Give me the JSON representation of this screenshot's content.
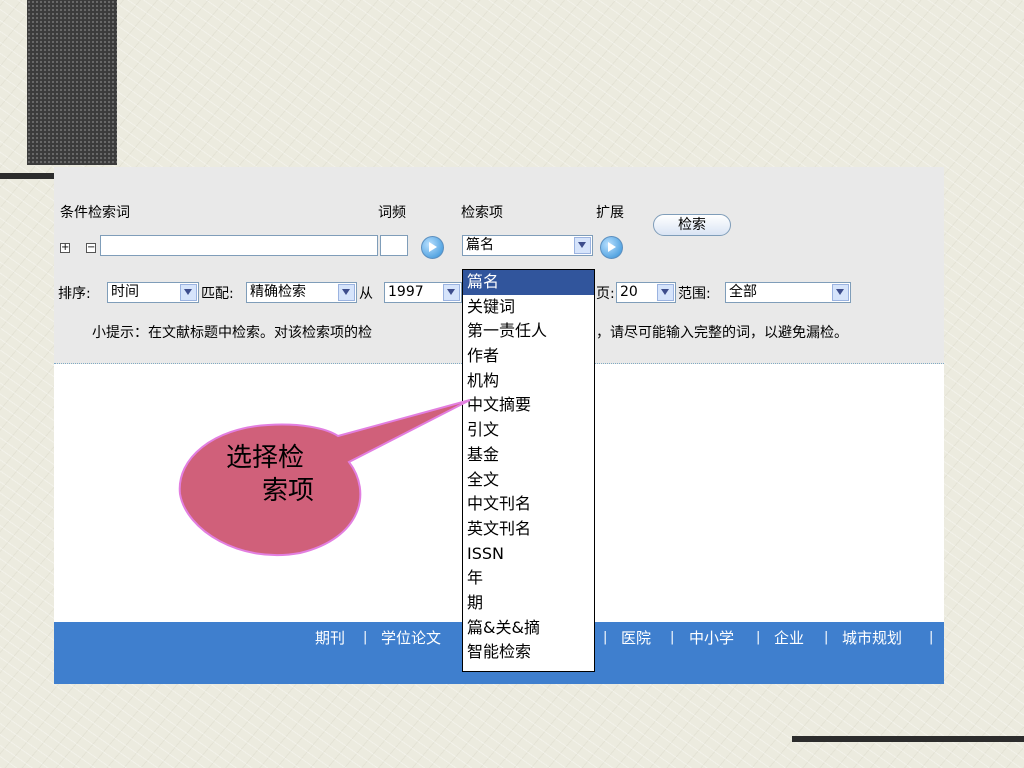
{
  "labels": {
    "condition_term": "条件检索词",
    "frequency": "词频",
    "search_field": "检索项",
    "expand": "扩展",
    "sort": "排序:",
    "match": "匹配:",
    "from": "从",
    "per_page_suffix": "页:",
    "range": "范围:"
  },
  "buttons": {
    "search": "检索",
    "plus": "+",
    "minus": "−"
  },
  "fields": {
    "term_value": "",
    "frequency_value": "",
    "search_field_value": "篇名",
    "sort_value": "时间",
    "match_value": "精确检索",
    "year_from_value": "1997",
    "per_page_value": "20",
    "range_value": "全部"
  },
  "tip": {
    "left": "小提示：在文献标题中检索。对该检索项的检",
    "right": "，请尽可能输入完整的词，以避免漏检。"
  },
  "dropdown": {
    "options": [
      "篇名",
      "关键词",
      "第一责任人",
      "作者",
      "机构",
      "中文摘要",
      "引文",
      "基金",
      "全文",
      "中文刊名",
      "英文刊名",
      "ISSN",
      "年",
      "期",
      "篇&关&摘",
      "智能检索"
    ],
    "selected_index": 0
  },
  "nav": {
    "left_items": [
      "期刊",
      "学位论文"
    ],
    "right_items": [
      "医院",
      "中小学",
      "企业",
      "城市规划"
    ],
    "separator": "|"
  },
  "callout": {
    "line1": "选择检",
    "line2": "索项",
    "fill_color": "#d0607a",
    "border_color": "#e27fe0"
  },
  "colors": {
    "panel": "#e9e9e9",
    "nav_bar": "#3f7fce",
    "dropdown_highlight": "#31559c"
  }
}
